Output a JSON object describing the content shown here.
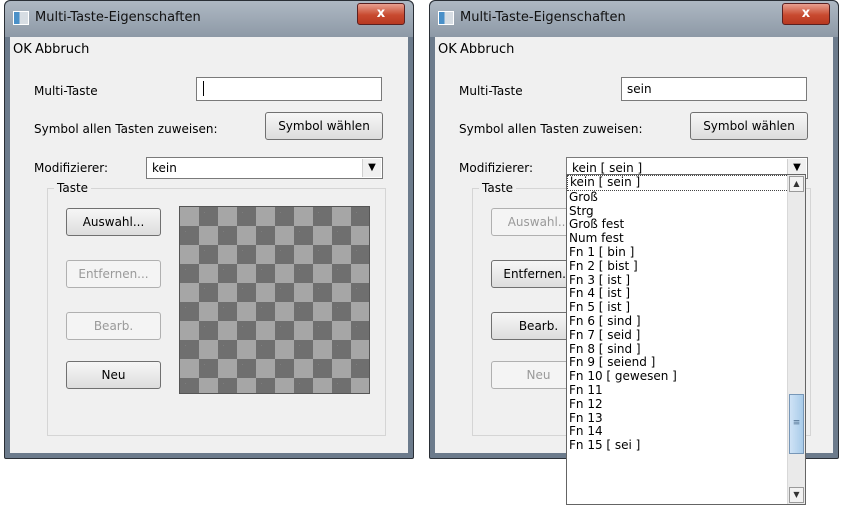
{
  "window_left": {
    "title": "Multi-Taste-Eigenschaften",
    "close": "x",
    "menu": {
      "ok": "OK",
      "cancel": "Abbruch"
    },
    "multikey_label": "Multi-Taste",
    "multikey_value": "",
    "assign_label": "Symbol allen Tasten zuweisen:",
    "symbol_button": "Symbol wählen",
    "modifier_label": "Modifizierer:",
    "modifier_value": "kein",
    "group_label": "Taste",
    "buttons": {
      "select": "Auswahl...",
      "remove": "Entfernen...",
      "edit": "Bearb.",
      "new": "Neu"
    }
  },
  "window_right": {
    "title": "Multi-Taste-Eigenschaften",
    "close": "x",
    "menu": {
      "ok": "OK",
      "cancel": "Abbruch"
    },
    "multikey_label": "Multi-Taste",
    "multikey_value": "sein",
    "assign_label": "Symbol allen Tasten zuweisen:",
    "symbol_button": "Symbol wählen",
    "modifier_label": "Modifizierer:",
    "modifier_value": "kein [ sein ]",
    "group_label": "Taste",
    "buttons": {
      "select": "Auswahl...",
      "remove": "Entfernen...",
      "edit": "Bearb.",
      "new": "Neu"
    },
    "dropdown_items": [
      "kein [ sein ]",
      "Groß",
      "Strg",
      "Groß fest",
      "Num fest",
      "Fn 1 [ bin ]",
      "Fn 2 [ bist ]",
      "Fn 3 [ ist ]",
      "Fn 4 [ ist ]",
      "Fn 5 [ ist ]",
      "Fn 6 [ sind ]",
      "Fn 7 [ seid ]",
      "Fn 8 [ sind ]",
      "Fn 9 [ seiend ]",
      "Fn 10 [ gewesen ]",
      "Fn 11",
      "Fn 12",
      "Fn 13",
      "Fn 14",
      "Fn 15 [ sei ]"
    ]
  },
  "icons": {
    "scroll_up": "▲",
    "scroll_down": "▼",
    "combo_arrow": "▼",
    "thumb_grip": "≡"
  }
}
